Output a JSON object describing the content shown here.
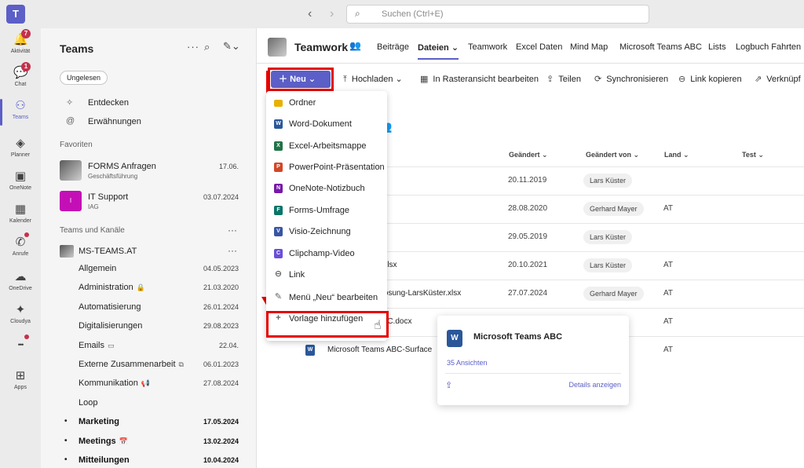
{
  "app": {
    "logo": "T"
  },
  "search": {
    "placeholder": "Suchen (Ctrl+E)"
  },
  "rail": [
    {
      "label": "Aktivität",
      "icon": "bell-icon",
      "glyph": "🔔",
      "badge": "7"
    },
    {
      "label": "Chat",
      "icon": "chat-icon",
      "glyph": "💬",
      "badge": "1"
    },
    {
      "label": "Teams",
      "icon": "teams-icon",
      "glyph": "⚇",
      "active": true
    },
    {
      "label": "Planner",
      "icon": "planner-icon",
      "glyph": "◈"
    },
    {
      "label": "OneNote",
      "icon": "onenote-icon",
      "glyph": "▣"
    },
    {
      "label": "Kalender",
      "icon": "calendar-icon",
      "glyph": "▦"
    },
    {
      "label": "Anrufe",
      "icon": "phone-icon",
      "glyph": "✆",
      "dot": true
    },
    {
      "label": "OneDrive",
      "icon": "cloud-icon",
      "glyph": "☁"
    },
    {
      "label": "Cloudya",
      "icon": "cloudya-icon",
      "glyph": "✦"
    },
    {
      "label": "",
      "icon": "more-apps-icon",
      "glyph": "•••",
      "dot": true
    },
    {
      "label": "Apps",
      "icon": "apps-icon",
      "glyph": "⊞"
    }
  ],
  "sidebar": {
    "title": "Teams",
    "filter": "Ungelesen",
    "quick": [
      {
        "label": "Entdecken",
        "glyph": "✧"
      },
      {
        "label": "Erwähnungen",
        "glyph": "@"
      }
    ],
    "favorites_heading": "Favoriten",
    "favorites": [
      {
        "name": "FORMS Anfragen",
        "sub": "Geschäftsführung",
        "date": "17.06."
      },
      {
        "name": "IT Support",
        "sub": "IAG",
        "date": "03.07.2024",
        "letter": "I"
      }
    ],
    "teams_heading": "Teams und Kanäle",
    "team_name": "MS-TEAMS.AT",
    "channels": [
      {
        "name": "Allgemein",
        "date": "04.05.2023"
      },
      {
        "name": "Administration",
        "suffix": "🔒",
        "date": "21.03.2020"
      },
      {
        "name": "Automatisierung",
        "date": "26.01.2024"
      },
      {
        "name": "Digitalisierungen",
        "date": "29.08.2023"
      },
      {
        "name": "Emails",
        "suffix": "▭",
        "date": "22.04."
      },
      {
        "name": "Externe Zusammenarbeit",
        "suffix": "⧉",
        "date": "06.01.2023"
      },
      {
        "name": "Kommunikation",
        "suffix": "📢",
        "date": "27.08.2024"
      },
      {
        "name": "Loop",
        "date": ""
      },
      {
        "name": "Marketing",
        "date": "17.05.2024",
        "bold": true
      },
      {
        "name": "Meetings",
        "suffix": "📅",
        "date": "13.02.2024",
        "bold": true
      },
      {
        "name": "Mitteilungen",
        "date": "10.04.2024",
        "bold": true
      }
    ]
  },
  "main": {
    "team_title": "Teamwork",
    "tabs": [
      "Beiträge",
      "Dateien",
      "Teamwork",
      "Excel Daten",
      "Mind Map",
      "Microsoft Teams ABC",
      "Lists",
      "Logbuch Fahrten"
    ],
    "tab_active_chevron": "⌄",
    "toolbar": {
      "new": "Neu",
      "upload": "Hochladen",
      "grid_edit": "In Rasteransicht bearbeiten",
      "share": "Teilen",
      "sync": "Synchronisieren",
      "copy_link": "Link kopieren",
      "link_more": "Verknüpf"
    },
    "content_title": "rk",
    "columns": {
      "changed": "Geändert",
      "changed_by": "Geändert von",
      "country": "Land",
      "test": "Test"
    },
    "rows": [
      {
        "file": "",
        "date": "20.11.2019",
        "by": "Lars Küster",
        "country": ""
      },
      {
        "file": "",
        "date": "28.08.2020",
        "by": "Gerhard Mayer",
        "country": "AT"
      },
      {
        "file": "",
        "date": "29.05.2019",
        "by": "Lars Küster",
        "country": ""
      },
      {
        "file": "n.xlsx",
        "date": "20.10.2021",
        "by": "Lars Küster",
        "country": "AT"
      },
      {
        "file": "-Lösung-LarsKüster.xlsx",
        "date": "27.07.2024",
        "by": "Gerhard Mayer",
        "country": "AT"
      },
      {
        "file": "ABC.docx",
        "date": "",
        "by": "",
        "country": "AT"
      },
      {
        "file": "Microsoft Teams ABC-Surface",
        "date": "",
        "by": "",
        "country": "AT"
      }
    ]
  },
  "new_menu": [
    {
      "label": "Ordner",
      "icon": "folder-icon",
      "color": "#e8b100",
      "letter": ""
    },
    {
      "label": "Word-Dokument",
      "icon": "word-icon",
      "color": "#2b579a",
      "letter": "W"
    },
    {
      "label": "Excel-Arbeitsmappe",
      "icon": "excel-icon",
      "color": "#217346",
      "letter": "X"
    },
    {
      "label": "PowerPoint-Präsentation",
      "icon": "powerpoint-icon",
      "color": "#d24726",
      "letter": "P"
    },
    {
      "label": "OneNote-Notizbuch",
      "icon": "onenote-file-icon",
      "color": "#7719aa",
      "letter": "N"
    },
    {
      "label": "Forms-Umfrage",
      "icon": "forms-icon",
      "color": "#077568",
      "letter": "F"
    },
    {
      "label": "Visio-Zeichnung",
      "icon": "visio-icon",
      "color": "#3955a3",
      "letter": "V"
    },
    {
      "label": "Clipchamp-Video",
      "icon": "clipchamp-icon",
      "color": "#6b4fd8",
      "letter": "C"
    },
    {
      "label": "Link",
      "icon": "link-icon",
      "color": "",
      "letter": ""
    },
    {
      "label": "Menü „Neu“ bearbeiten",
      "icon": "edit-icon",
      "color": "",
      "letter": ""
    },
    {
      "label": "Vorlage hinzufügen",
      "icon": "plus-icon",
      "color": "",
      "letter": ""
    }
  ],
  "hover_card": {
    "title": "Microsoft Teams ABC",
    "views": "35 Ansichten",
    "details": "Details anzeigen"
  },
  "colors": {
    "brand": "#5b5fc7",
    "annotation": "#e60000"
  }
}
